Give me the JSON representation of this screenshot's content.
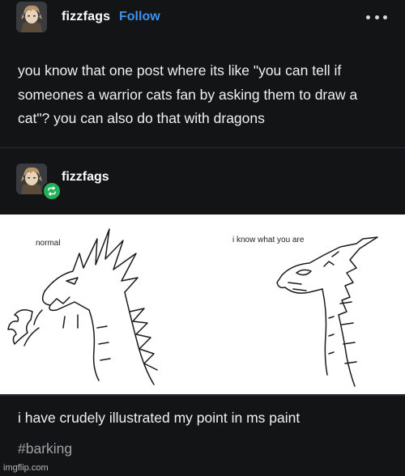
{
  "post": {
    "author": "fizzfags",
    "follow_label": "Follow",
    "menu_icon": "more-dots-icon",
    "text": "you know that one post where its like \"you can tell if someones a warrior cats fan by asking them to draw a cat\"? you can also do that with dragons"
  },
  "reblog": {
    "author": "fizzfags",
    "badge_icon": "reblog-icon",
    "image": {
      "left_caption": "normal",
      "right_caption": "i know what you are"
    },
    "text": "i have crudely illustrated my point in ms paint",
    "tag": "#barking"
  },
  "watermark": "imgflip.com",
  "colors": {
    "background": "#131416",
    "follow": "#3f93ee",
    "reblog_badge": "#22b15a",
    "tag": "#a0a3a8"
  }
}
